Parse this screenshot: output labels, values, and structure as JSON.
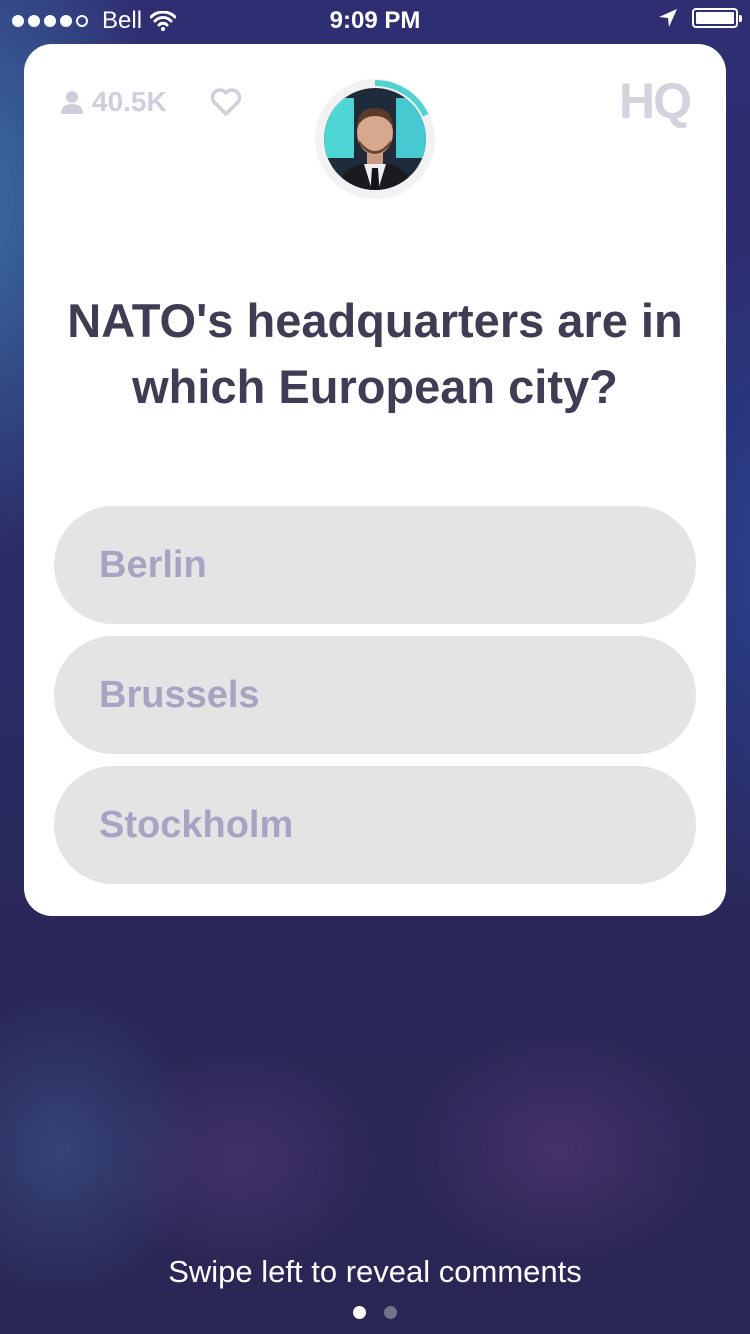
{
  "status_bar": {
    "carrier": "Bell",
    "time": "9:09 PM",
    "signal_dots": 5,
    "signal_filled": 4
  },
  "header": {
    "viewer_count": "40.5K",
    "logo": "HQ",
    "icons": [
      "person-icon",
      "heart-icon"
    ]
  },
  "host": {
    "avatar": "host-avatar",
    "timer_progress": 0.18,
    "timer_color": "#52d3d0"
  },
  "question": {
    "text": "NATO's headquarters are in which European city?"
  },
  "answers": [
    {
      "label": "Berlin"
    },
    {
      "label": "Brussels"
    },
    {
      "label": "Stockholm"
    }
  ],
  "footer": {
    "hint": "Swipe left to reveal comments",
    "pages": 2,
    "active_page": 1
  },
  "colors": {
    "question_text": "#3f3d53",
    "answer_bg": "#e4e4e4",
    "answer_text": "#a6a4c2",
    "background": "#2b2a66"
  }
}
